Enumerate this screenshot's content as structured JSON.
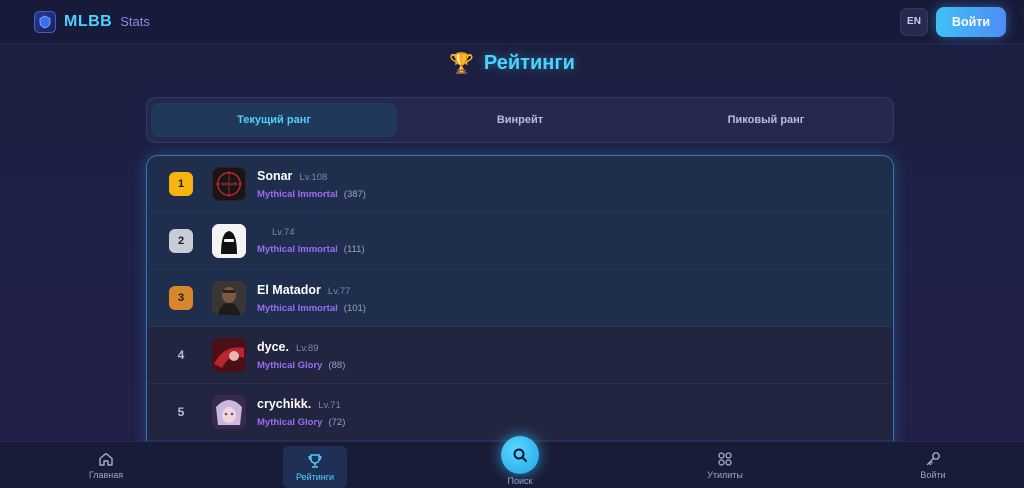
{
  "header": {
    "brand_title": "MLBB",
    "brand_sub": "Stats",
    "lang": "EN",
    "login_label": "Войти"
  },
  "page": {
    "title": "Рейтинги",
    "trophy_icon": "🏆"
  },
  "tabs": [
    {
      "label": "Текущий ранг",
      "active": true
    },
    {
      "label": "Винрейт",
      "active": false
    },
    {
      "label": "Пиковый ранг",
      "active": false
    }
  ],
  "players": [
    {
      "rank": "1",
      "name": "Sonar",
      "level": "Lv.108",
      "tier": "Mythical Immortal",
      "stars": "(387)",
      "badge_color": "#f5b40f",
      "avatar": "sonar-avatar"
    },
    {
      "rank": "2",
      "name": "",
      "level": "Lv.74",
      "tier": "Mythical Immortal",
      "stars": "(111)",
      "badge_color": "#c9ccd6",
      "avatar": "ghost-avatar"
    },
    {
      "rank": "3",
      "name": "El Matador",
      "level": "Lv.77",
      "tier": "Mythical Immortal",
      "stars": "(101)",
      "badge_color": "#d8862b",
      "avatar": "matador-avatar"
    },
    {
      "rank": "4",
      "name": "dyce.",
      "level": "Lv.89",
      "tier": "Mythical Glory",
      "stars": "(88)",
      "avatar": "dyce-avatar"
    },
    {
      "rank": "5",
      "name": "crychikk.",
      "level": "Lv.71",
      "tier": "Mythical Glory",
      "stars": "(72)",
      "avatar": "crychikk-avatar"
    }
  ],
  "nav": {
    "home": "Главная",
    "ratings": "Рейтинги",
    "search": "Поиск",
    "utilities": "Утилиты",
    "login": "Войти"
  },
  "colors": {
    "accent": "#4fd1ff",
    "tier": "#9a6cf5",
    "gold": "#f5b40f",
    "silver": "#c9ccd6",
    "bronze": "#d8862b"
  }
}
